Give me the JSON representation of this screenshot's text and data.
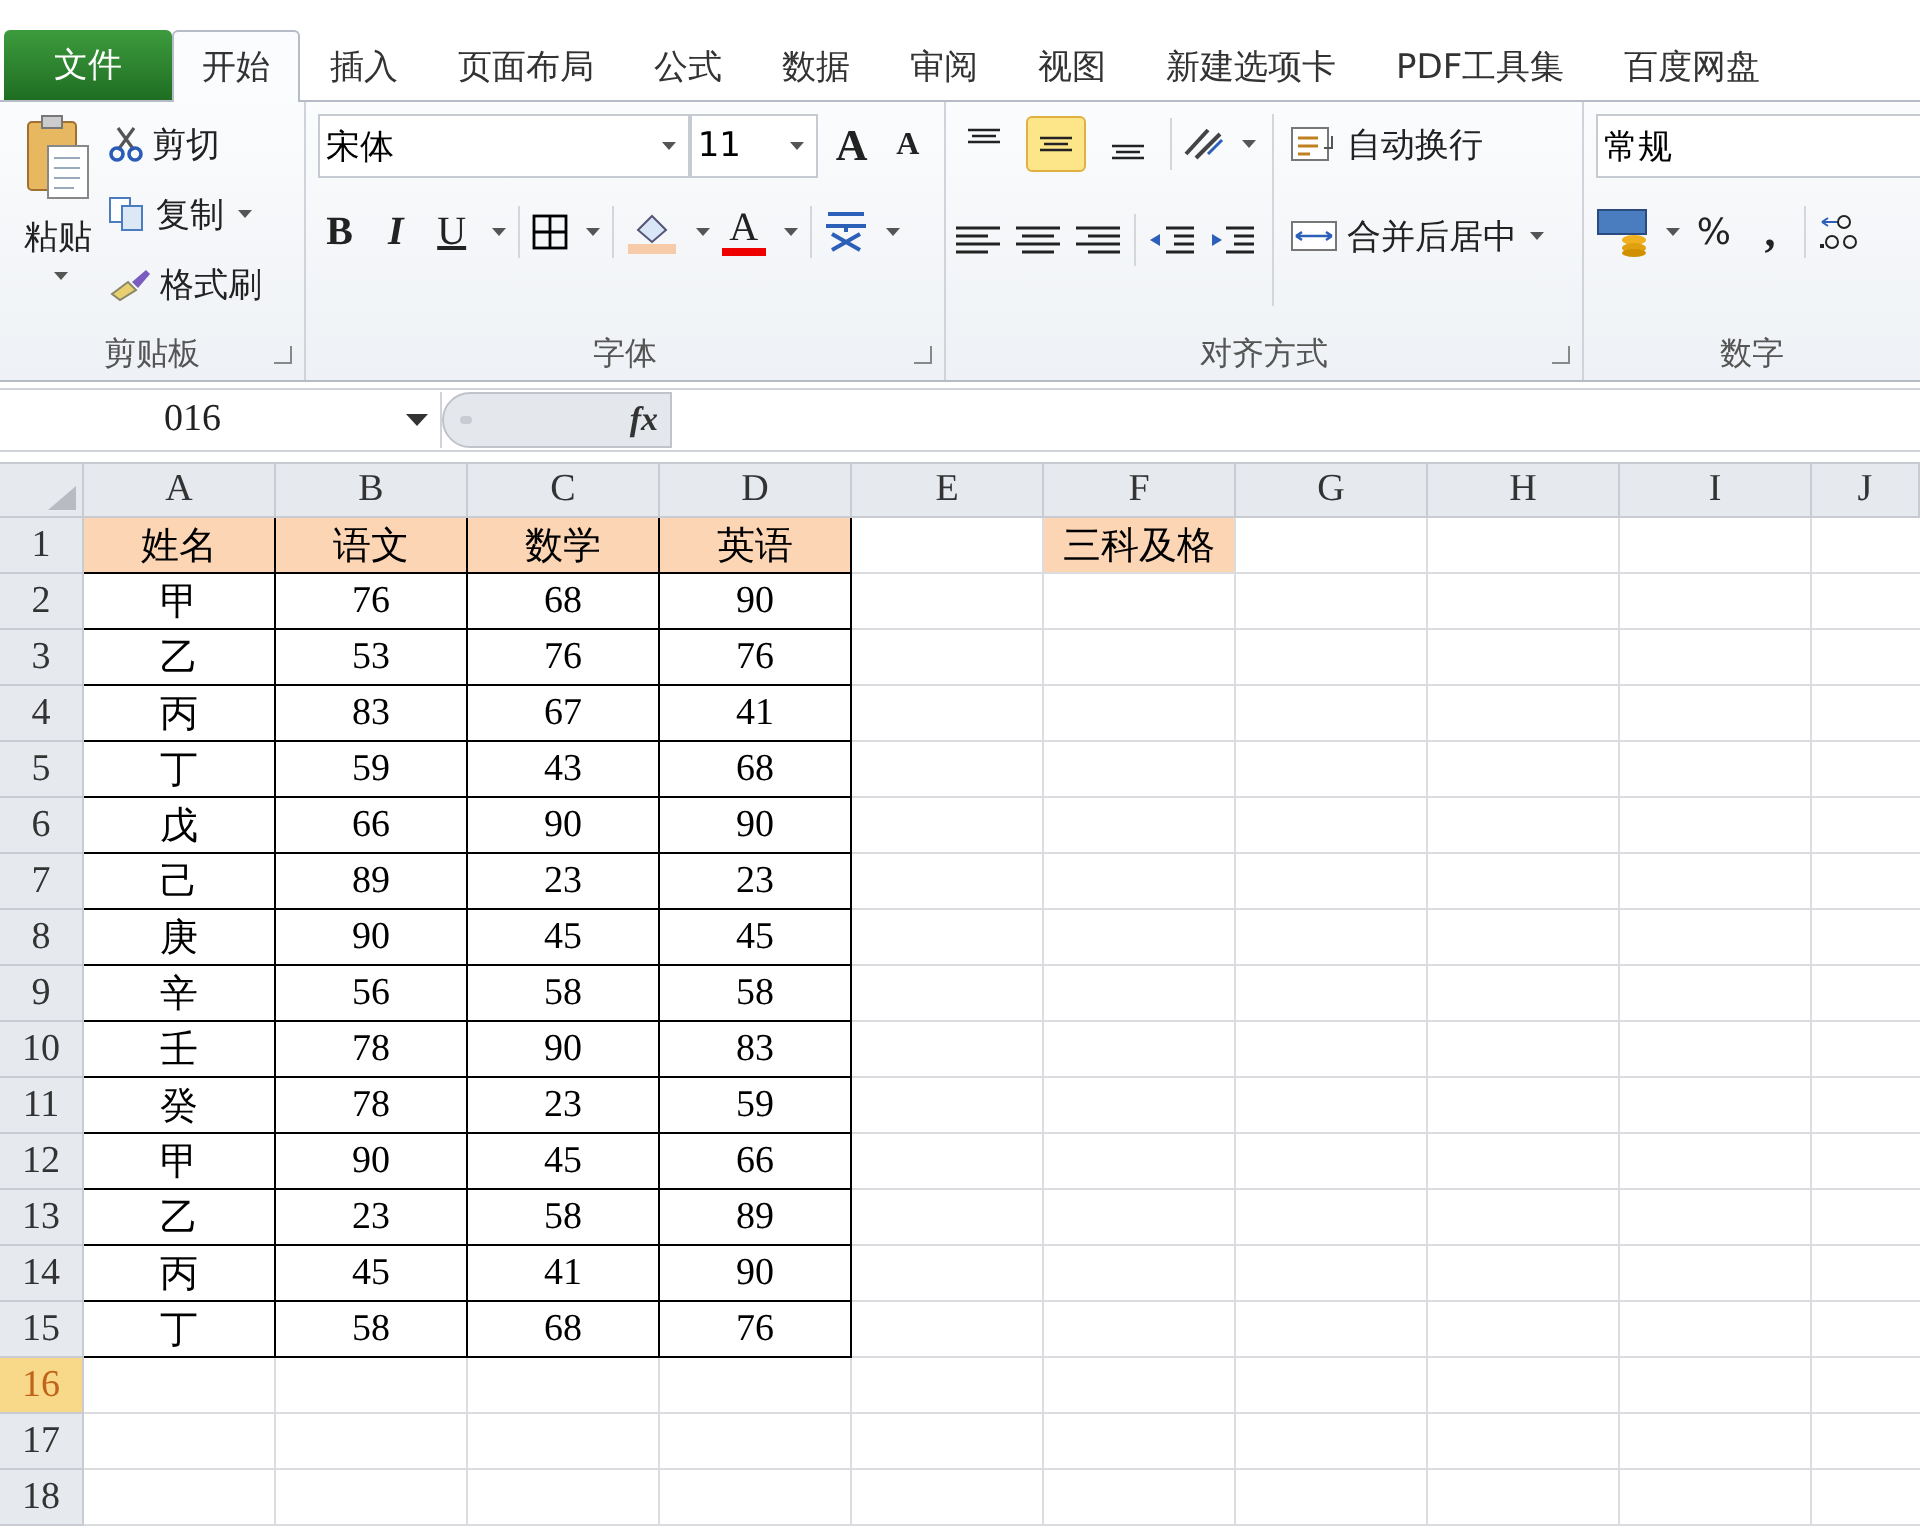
{
  "tabs": [
    {
      "label": "文件",
      "kind": "file",
      "selected": false
    },
    {
      "label": "开始",
      "kind": "tab",
      "selected": true
    },
    {
      "label": "插入",
      "kind": "tab",
      "selected": false
    },
    {
      "label": "页面布局",
      "kind": "tab",
      "selected": false
    },
    {
      "label": "公式",
      "kind": "tab",
      "selected": false
    },
    {
      "label": "数据",
      "kind": "tab",
      "selected": false
    },
    {
      "label": "审阅",
      "kind": "tab",
      "selected": false
    },
    {
      "label": "视图",
      "kind": "tab",
      "selected": false
    },
    {
      "label": "新建选项卡",
      "kind": "tab",
      "selected": false
    },
    {
      "label": "PDF工具集",
      "kind": "tab",
      "selected": false
    },
    {
      "label": "百度网盘",
      "kind": "tab",
      "selected": false
    }
  ],
  "clipboard": {
    "paste": "粘贴",
    "cut": "剪切",
    "copy": "复制",
    "format_painter": "格式刷",
    "label": "剪贴板"
  },
  "font": {
    "name": "宋体",
    "size": "11",
    "grow": "A",
    "shrink": "A",
    "bold": "B",
    "italic": "I",
    "underline": "U",
    "color_letter": "A",
    "label": "字体"
  },
  "alignment": {
    "top_buttons": [
      {
        "selected": false
      },
      {
        "selected": true
      },
      {
        "selected": false
      }
    ],
    "wrap": "自动换行",
    "merge": "合并后居中",
    "label": "对齐方式"
  },
  "number": {
    "format": "常规",
    "percent": "%",
    "comma": ",",
    "label": "数字"
  },
  "formula_bar": {
    "name_box": "016",
    "fx": "fx"
  },
  "sheet": {
    "columns": [
      "A",
      "B",
      "C",
      "D",
      "E",
      "F",
      "G",
      "H",
      "I",
      "J"
    ],
    "rows": [
      {
        "label": "1",
        "kind": "header",
        "selected": false,
        "cells": [
          "姓名",
          "语文",
          "数学",
          "英语"
        ],
        "note": "三科及格"
      },
      {
        "label": "2",
        "kind": "data",
        "selected": false,
        "cells": [
          "甲",
          "76",
          "68",
          "90"
        ]
      },
      {
        "label": "3",
        "kind": "data",
        "selected": false,
        "cells": [
          "乙",
          "53",
          "76",
          "76"
        ]
      },
      {
        "label": "4",
        "kind": "data",
        "selected": false,
        "cells": [
          "丙",
          "83",
          "67",
          "41"
        ]
      },
      {
        "label": "5",
        "kind": "data",
        "selected": false,
        "cells": [
          "丁",
          "59",
          "43",
          "68"
        ]
      },
      {
        "label": "6",
        "kind": "data",
        "selected": false,
        "cells": [
          "戊",
          "66",
          "90",
          "90"
        ]
      },
      {
        "label": "7",
        "kind": "data",
        "selected": false,
        "cells": [
          "己",
          "89",
          "23",
          "23"
        ]
      },
      {
        "label": "8",
        "kind": "data",
        "selected": false,
        "cells": [
          "庚",
          "90",
          "45",
          "45"
        ]
      },
      {
        "label": "9",
        "kind": "data",
        "selected": false,
        "cells": [
          "辛",
          "56",
          "58",
          "58"
        ]
      },
      {
        "label": "10",
        "kind": "data",
        "selected": false,
        "cells": [
          "壬",
          "78",
          "90",
          "83"
        ]
      },
      {
        "label": "11",
        "kind": "data",
        "selected": false,
        "cells": [
          "癸",
          "78",
          "23",
          "59"
        ]
      },
      {
        "label": "12",
        "kind": "data",
        "selected": false,
        "cells": [
          "甲",
          "90",
          "45",
          "66"
        ]
      },
      {
        "label": "13",
        "kind": "data",
        "selected": false,
        "cells": [
          "乙",
          "23",
          "58",
          "89"
        ]
      },
      {
        "label": "14",
        "kind": "data",
        "selected": false,
        "cells": [
          "丙",
          "45",
          "41",
          "90"
        ]
      },
      {
        "label": "15",
        "kind": "data",
        "selected": false,
        "cells": [
          "丁",
          "58",
          "68",
          "76"
        ]
      },
      {
        "label": "16",
        "kind": "empty",
        "selected": true
      },
      {
        "label": "17",
        "kind": "empty",
        "selected": false
      },
      {
        "label": "18",
        "kind": "empty",
        "selected": false
      }
    ]
  }
}
